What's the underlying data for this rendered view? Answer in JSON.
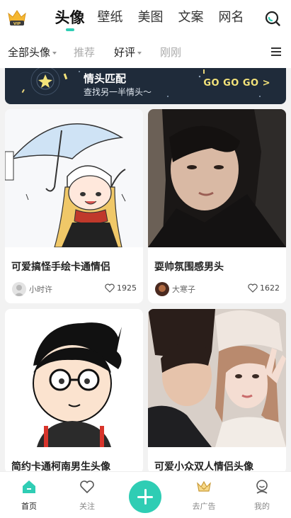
{
  "top_nav": {
    "tabs": [
      {
        "label": "头像",
        "active": true
      },
      {
        "label": "壁纸",
        "active": false
      },
      {
        "label": "美图",
        "active": false
      },
      {
        "label": "文案",
        "active": false
      },
      {
        "label": "网名",
        "active": false
      }
    ],
    "vip_badge": "VIP"
  },
  "sub_nav": {
    "items": [
      {
        "label": "全部头像",
        "has_caret": true
      },
      {
        "label": "推荐",
        "has_caret": false
      },
      {
        "label": "好评",
        "has_caret": true
      },
      {
        "label": "刚刚",
        "has_caret": false
      }
    ]
  },
  "banner": {
    "title": "情头匹配",
    "subtitle": "查找另一半情头～",
    "cta": "GO GO GO >"
  },
  "cards": [
    {
      "title": "可爱搞怪手绘卡通情侣",
      "author": "小时许",
      "likes": "1925"
    },
    {
      "title": "耍帅氛围感男头",
      "author": "大寒子",
      "likes": "1622"
    },
    {
      "title": "简约卡通柯南男生头像",
      "author": "",
      "likes": ""
    },
    {
      "title": "可爱小众双人情侣头像",
      "author": "",
      "likes": ""
    }
  ],
  "bottom_nav": {
    "items": [
      {
        "label": "首页",
        "active": true
      },
      {
        "label": "关注",
        "active": false
      },
      {
        "label": "去广告",
        "active": false
      },
      {
        "label": "我的",
        "active": false
      }
    ]
  },
  "colors": {
    "accent": "#2fcdb4",
    "banner_bg": "#1f2b3a",
    "banner_cta": "#f3e37a"
  }
}
